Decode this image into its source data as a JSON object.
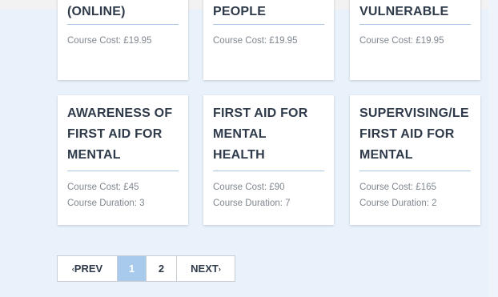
{
  "courses_row1": [
    {
      "title": "(ONLINE)",
      "cost": "Course Cost: £19.95"
    },
    {
      "title": "PEOPLE",
      "cost": "Course Cost: £19.95"
    },
    {
      "title": "VULNERABLE",
      "cost": "Course Cost: £19.95"
    }
  ],
  "courses_row2": [
    {
      "title_lines": [
        "AWARENESS OF",
        "FIRST AID FOR",
        "MENTAL"
      ],
      "cost": "Course Cost: £45",
      "duration": "Course Duration: 3"
    },
    {
      "title_lines": [
        "FIRST AID FOR",
        "MENTAL",
        "HEALTH"
      ],
      "cost": "Course Cost: £90",
      "duration": "Course Duration: 7"
    },
    {
      "title_lines": [
        "SUPERVISING/LE",
        "FIRST AID FOR",
        "MENTAL"
      ],
      "cost": "Course Cost: £165",
      "duration": "Course Duration: 2"
    }
  ],
  "pagination": {
    "prev_chevron": "‹",
    "prev_label": "PREV",
    "pages": [
      "1",
      "2"
    ],
    "current_page": "1",
    "next_label": "NEXT",
    "next_chevron": "›"
  },
  "colors": {
    "background": "#e9f2fb",
    "active_page": "#a8cbeb",
    "divider": "#a9c7e4",
    "title_text": "#2f3b4a"
  }
}
